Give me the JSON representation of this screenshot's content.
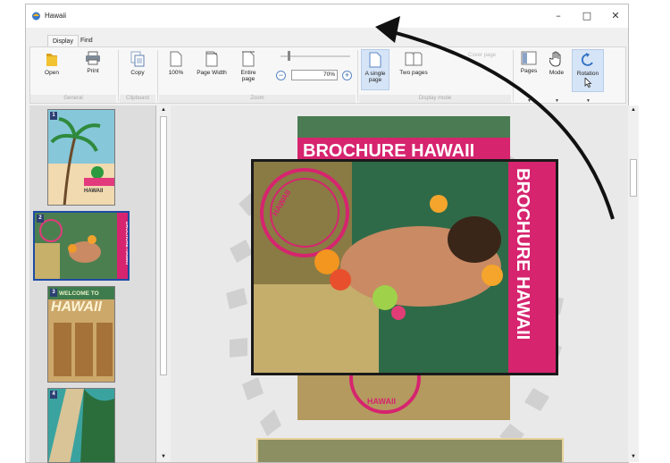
{
  "window": {
    "title": "Hawaii",
    "controls": {
      "minimize": "–",
      "maximize": "□",
      "close": "✕"
    }
  },
  "tabs": [
    {
      "label": "Display"
    },
    {
      "label": "Find"
    }
  ],
  "ribbon": {
    "open": "Open",
    "print": "Print",
    "copy": "Copy",
    "zoom100": "100%",
    "page_width": "Page Width",
    "entire_page": "Entire page",
    "zoom_value": "70%",
    "single_page": "A single page",
    "two_pages": "Two pages",
    "cover_page": "Cover page",
    "pages": "Pages",
    "mode": "Mode",
    "rotation": "Rotation",
    "groups": {
      "general": "General",
      "clipboard": "Clipboard",
      "zoom": "Zoom",
      "display_mode": "Display mode"
    }
  },
  "thumbnails": [
    {
      "number": "1",
      "title": "HAWAII"
    },
    {
      "number": "2",
      "title": "BROCHURE HAWAII"
    },
    {
      "number": "3",
      "title": "WELCOME TO",
      "subtitle": "HAWAII"
    },
    {
      "number": "4"
    }
  ],
  "document": {
    "page_title": "BROCHURE HAWAII",
    "side_title": "BROCHURE HAWAII",
    "stamp_text": "HAWAII",
    "stamp_text_bottom": "HAWAII"
  },
  "colors": {
    "accent": "#3b67a6",
    "brochure_pink": "#d6246f",
    "selection": "#d5e4f6"
  }
}
